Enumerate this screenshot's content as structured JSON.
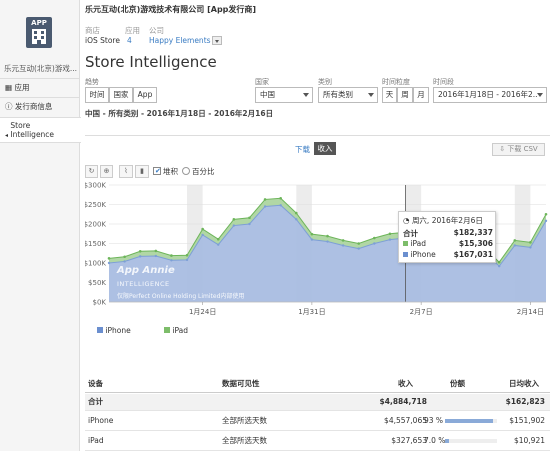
{
  "sidebar": {
    "app_icon_label": "APP",
    "app_name": "乐元互动(北京)游戏...",
    "items": [
      {
        "icon": "grid-icon",
        "label": "应用"
      },
      {
        "icon": "info-icon",
        "label": "发行商信息"
      },
      {
        "icon": "caret-icon",
        "label": "Store Intelligence"
      }
    ]
  },
  "header": {
    "company": "乐元互动(北京)游戏技术有限公司 [App发行商]",
    "col_store": "商店",
    "col_apps": "应用",
    "col_company": "公司",
    "store": "iOS Store",
    "app_count": "4",
    "company_link": "Happy Elements"
  },
  "page_title": "Store Intelligence",
  "filters": {
    "labels": [
      "趋势",
      "国家",
      "类别",
      "时间粒度",
      "时间段"
    ],
    "trend_buttons": [
      "时间",
      "国家",
      "App"
    ],
    "country": "中国",
    "category": "所有类别",
    "granularity": [
      "天",
      "周",
      "月"
    ],
    "date_range": "2016年1月18日 - 2016年2..."
  },
  "subtitle": "中国 - 所有类别 - 2016年1月18日 - 2016年2月16日",
  "metric_tabs": [
    "下载",
    "收入"
  ],
  "export_label": "下载 CSV",
  "chart_tools": {
    "stack_label": "堆积",
    "percent_label": "百分比"
  },
  "watermark": {
    "title": "App Annie",
    "sub": "INTELLIGENCE",
    "note": "仅限Perfect Online Holding Limited内部使用"
  },
  "tooltip": {
    "date": "周六, 2016年2月6日",
    "rows": [
      {
        "label": "合计",
        "value": "$182,337"
      },
      {
        "label": "iPad",
        "value": "$15,306"
      },
      {
        "label": "iPhone",
        "value": "$167,031"
      }
    ]
  },
  "legend": [
    {
      "name": "iPhone",
      "color": "#6b8fcf"
    },
    {
      "name": "iPad",
      "color": "#7dbd6a"
    }
  ],
  "chart_data": {
    "type": "area",
    "stacked": true,
    "x_start": "2016-01-18",
    "x_end": "2016-02-16",
    "x_tick_labels": [
      "1月24日",
      "1月31日",
      "2月7日",
      "2月14日"
    ],
    "y_tick_labels": [
      "0K",
      "50K",
      "100K",
      "150K",
      "200K",
      "250K",
      "300K"
    ],
    "ylim": [
      0,
      300000
    ],
    "series": [
      {
        "name": "iPhone",
        "color": "#9fb6dd",
        "values": [
          100000,
          104000,
          117000,
          118000,
          107000,
          108000,
          172000,
          147000,
          196000,
          200000,
          245000,
          248000,
          212000,
          160000,
          155000,
          145000,
          137000,
          150000,
          160000,
          164000,
          167031,
          152000,
          150000,
          125000,
          130000,
          92000,
          145000,
          140000,
          208000
        ]
      },
      {
        "name": "iPad",
        "color": "#7dbd6a",
        "values": [
          12000,
          12000,
          13000,
          13000,
          12000,
          12000,
          15000,
          14000,
          16000,
          16000,
          18000,
          18000,
          16000,
          14000,
          14000,
          13000,
          13000,
          14000,
          15000,
          15000,
          15306,
          14000,
          14000,
          12000,
          12000,
          10000,
          13000,
          13000,
          17000
        ]
      }
    ]
  },
  "table": {
    "headers": [
      "设备",
      "数据可见性",
      "收入",
      "份额",
      "日均收入"
    ],
    "rows": [
      {
        "device": "合计",
        "visibility": "",
        "revenue": "$4,884,718",
        "share": "",
        "share_pct": 0,
        "avg": "$162,823"
      },
      {
        "device": "iPhone",
        "visibility": "全部所选天数",
        "revenue": "$4,557,065",
        "share": "93 %",
        "share_pct": 0.93,
        "avg": "$151,902"
      },
      {
        "device": "iPad",
        "visibility": "全部所选天数",
        "revenue": "$327,653",
        "share": "7.0 %",
        "share_pct": 0.07,
        "avg": "$10,921"
      }
    ]
  }
}
